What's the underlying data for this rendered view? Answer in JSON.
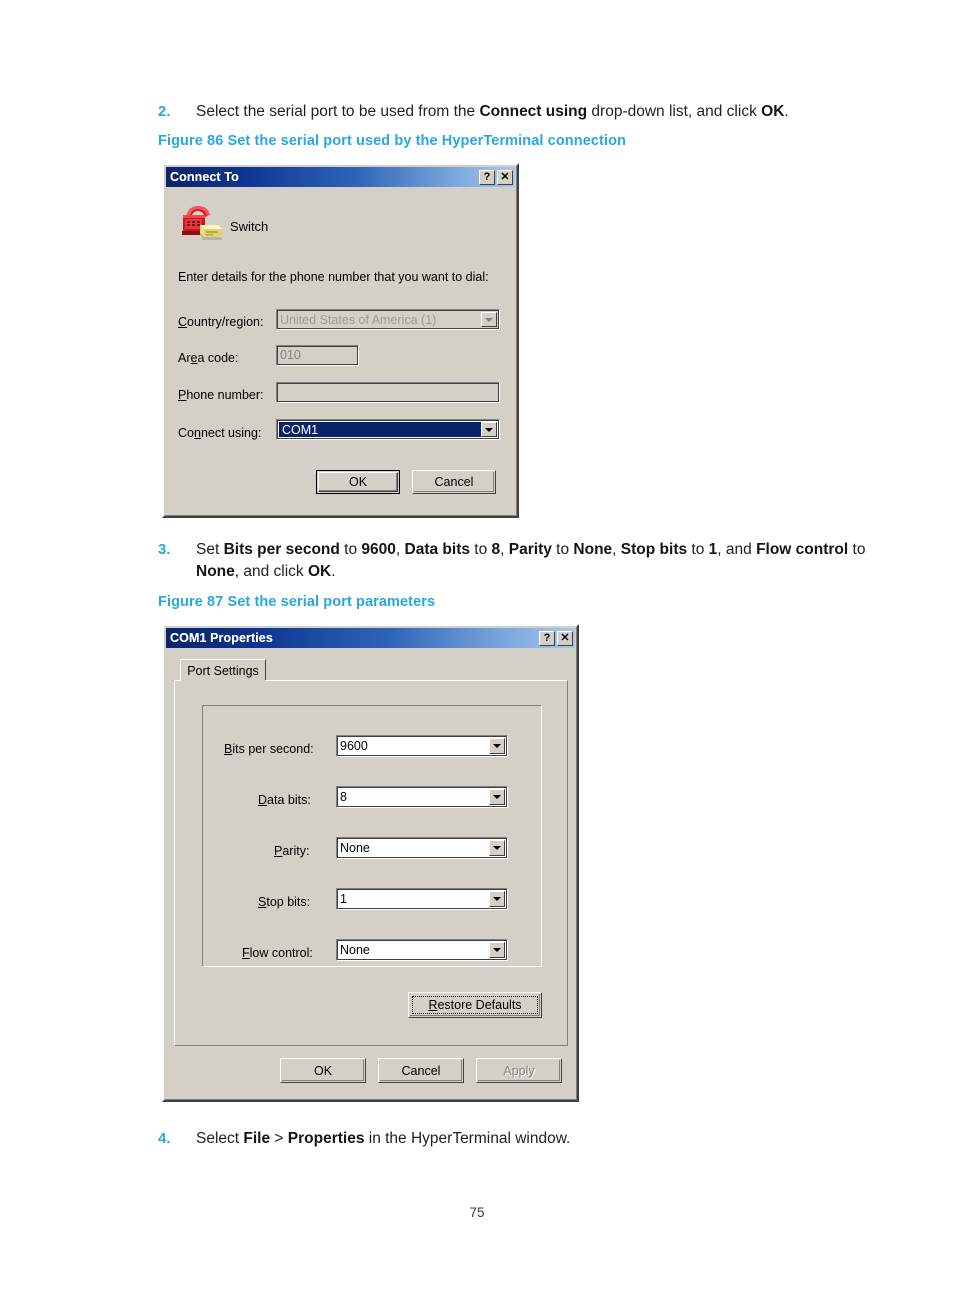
{
  "document": {
    "page_number": "75",
    "steps": [
      {
        "number": "2.",
        "text_html": "Select the serial port to be used from the <b>Connect using</b> drop-down list, and click <b>OK</b>."
      },
      {
        "number": "3.",
        "text_html": "Set <b>Bits per second</b> to <b>9600</b>, <b>Data bits</b> to <b>8</b>, <b>Parity</b> to <b>None</b>, <b>Stop bits</b> to <b>1</b>, and <b>Flow control</b> to <b>None</b>, and click <b>OK</b>."
      },
      {
        "number": "4.",
        "text_html": "Select <b>File</b> &gt; <b>Properties</b> in the HyperTerminal window."
      }
    ],
    "figures": [
      {
        "caption": "Figure 86 Set the serial port used by the HyperTerminal connection"
      },
      {
        "caption": "Figure 87 Set the serial port parameters"
      }
    ],
    "accent_color": "#29a8dd"
  },
  "connect_to_dialog": {
    "title": "Connect To",
    "help_button": "?",
    "close_button": "✕",
    "connection_name": "Switch",
    "instruction": "Enter details for the phone number that you want to dial:",
    "fields": {
      "country_region": {
        "label": "Country/region:",
        "label_accel": "C",
        "value": "United States of America (1)",
        "enabled": false
      },
      "area_code": {
        "label": "Area code:",
        "label_accel": "e",
        "value": "010",
        "enabled": false
      },
      "phone_number": {
        "label": "Phone number:",
        "label_accel": "P",
        "value": "",
        "enabled": false
      },
      "connect_using": {
        "label": "Connect using:",
        "label_accel": "n",
        "value": "COM1",
        "enabled": true,
        "selected": true,
        "options": [
          "COM1"
        ]
      }
    },
    "buttons": {
      "ok": "OK",
      "cancel": "Cancel"
    }
  },
  "com1_properties_dialog": {
    "title": "COM1 Properties",
    "help_button": "?",
    "close_button": "✕",
    "tab": "Port Settings",
    "settings": [
      {
        "label": "Bits per second:",
        "accel": "B",
        "value": "9600"
      },
      {
        "label": "Data bits:",
        "accel": "D",
        "value": "8"
      },
      {
        "label": "Parity:",
        "accel": "P",
        "value": "None"
      },
      {
        "label": "Stop bits:",
        "accel": "S",
        "value": "1"
      },
      {
        "label": "Flow control:",
        "accel": "F",
        "value": "None"
      }
    ],
    "restore_defaults_button": "Restore Defaults",
    "buttons": {
      "ok": "OK",
      "cancel": "Cancel",
      "apply": "Apply",
      "apply_enabled": false
    }
  },
  "colors": {
    "title_gradient_start": "#0a246a",
    "title_gradient_end": "#a6c8ec",
    "dialog_face": "#d4d0c8",
    "selection_blue": "#0a246a",
    "accent_cyan": "#29a8dd"
  }
}
